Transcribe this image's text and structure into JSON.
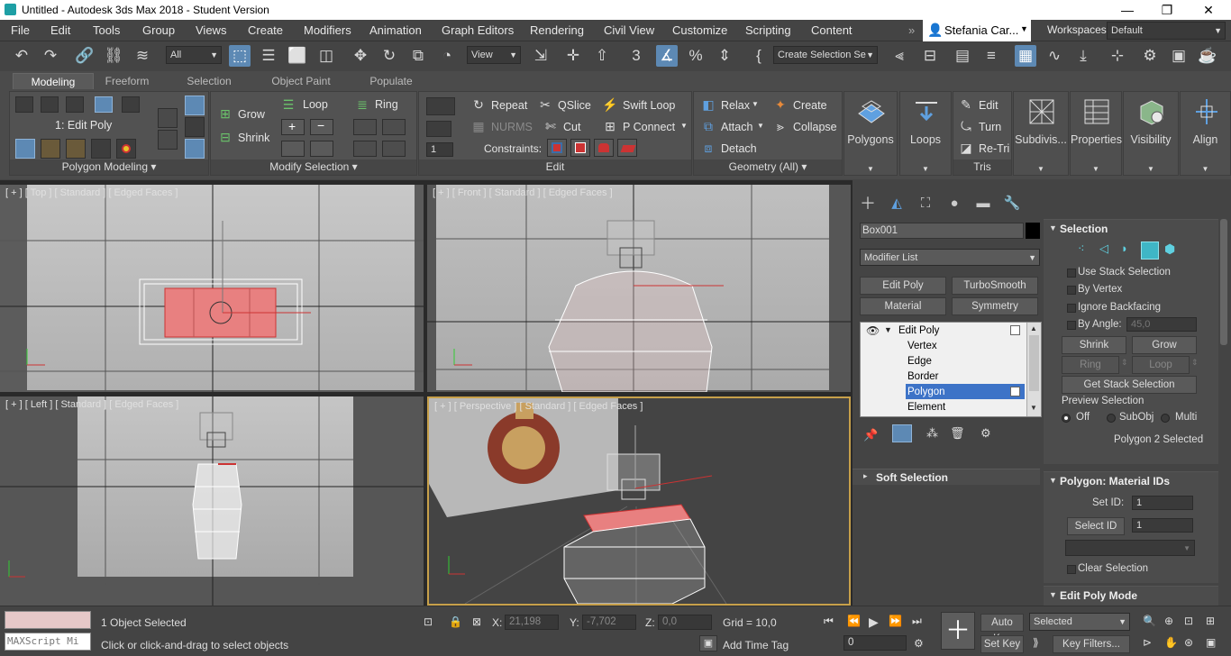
{
  "window": {
    "title": "Untitled - Autodesk 3ds Max 2018 - Student Version",
    "minimize": "—",
    "maximize": "❐",
    "close": "✕"
  },
  "menu": [
    "File",
    "Edit",
    "Tools",
    "Group",
    "Views",
    "Create",
    "Modifiers",
    "Animation",
    "Graph Editors",
    "Rendering",
    "Civil View",
    "Customize",
    "Scripting",
    "Content"
  ],
  "user": {
    "name": "Stefania Car...",
    "workspaces_label": "Workspaces:",
    "workspace": "Default"
  },
  "toolbar": {
    "filter": "All",
    "refcoord": "View",
    "selection_set": "Create Selection Se"
  },
  "ribbon": {
    "tabs": [
      "Modeling",
      "Freeform",
      "Selection",
      "Object Paint",
      "Populate"
    ],
    "mode_label": "1: Edit Poly",
    "panels": {
      "polygon_modeling": "Polygon Modeling",
      "modify_selection": "Modify Selection",
      "edit": "Edit",
      "geometry": "Geometry (All)",
      "tris": "Tris"
    },
    "grow": "Grow",
    "shrink": "Shrink",
    "loop": "Loop",
    "ring": "Ring",
    "repeat": "Repeat",
    "qslice": "QSlice",
    "swift_loop": "Swift Loop",
    "nurms": "NURMS",
    "cut": "Cut",
    "p_connect": "P Connect",
    "constraints": "Constraints:",
    "spinner_value": "1",
    "relax": "Relax",
    "create": "Create",
    "attach": "Attach",
    "collapse": "Collapse",
    "detach": "Detach",
    "big": [
      "Polygons",
      "Loops",
      "Subdivis...",
      "Properties",
      "Visibility",
      "Align"
    ],
    "tris_items": [
      "Edit",
      "Turn",
      "Re-Tri"
    ]
  },
  "viewports": {
    "top": "[ + ] [ Top ] [ Standard ] [ Edged Faces ]",
    "front": "[ + ] [ Front ] [ Standard ] [ Edged Faces ]",
    "left": "[ + ] [ Left ] [ Standard ] [ Edged Faces ]",
    "persp": "[ + ] [ Perspective ] [ Standard ] [ Edged Faces ]"
  },
  "command_panel": {
    "object_name": "Box001",
    "modifier_list": "Modifier List",
    "buttons": [
      "Edit Poly",
      "TurboSmooth",
      "Material",
      "Symmetry"
    ],
    "stack": [
      "Edit Poly",
      "Vertex",
      "Edge",
      "Border",
      "Polygon",
      "Element"
    ],
    "selected_sub": "Polygon",
    "soft_selection": "Soft Selection"
  },
  "selection_rollout": {
    "title": "Selection",
    "use_stack": "Use Stack Selection",
    "by_vertex": "By Vertex",
    "ignore_backfacing": "Ignore Backfacing",
    "by_angle": "By Angle:",
    "angle_value": "45,0",
    "shrink": "Shrink",
    "grow": "Grow",
    "ring": "Ring",
    "loop": "Loop",
    "get_stack": "Get Stack Selection",
    "preview": "Preview Selection",
    "off": "Off",
    "subobj": "SubObj",
    "multi": "Multi",
    "status": "Polygon 2 Selected"
  },
  "material_rollout": {
    "title": "Polygon: Material IDs",
    "set_id": "Set ID:",
    "set_val": "1",
    "select_id": "Select ID",
    "select_val": "1",
    "clear": "Clear Selection"
  },
  "edit_poly_mode": "Edit Poly Mode",
  "status": {
    "maxscript": "MAXScript Mi",
    "objects": "1 Object Selected",
    "prompt": "Click or click-and-drag to select objects",
    "x_label": "X:",
    "x": "21,198",
    "y_label": "Y:",
    "y": "-7,702",
    "z_label": "Z:",
    "z": "0,0",
    "grid": "Grid = 10,0",
    "add_time_tag": "Add Time Tag",
    "auto_key": "Auto Key",
    "set_key": "Set Key",
    "key_mode": "Selected",
    "key_filters": "Key Filters...",
    "frame": "0"
  }
}
